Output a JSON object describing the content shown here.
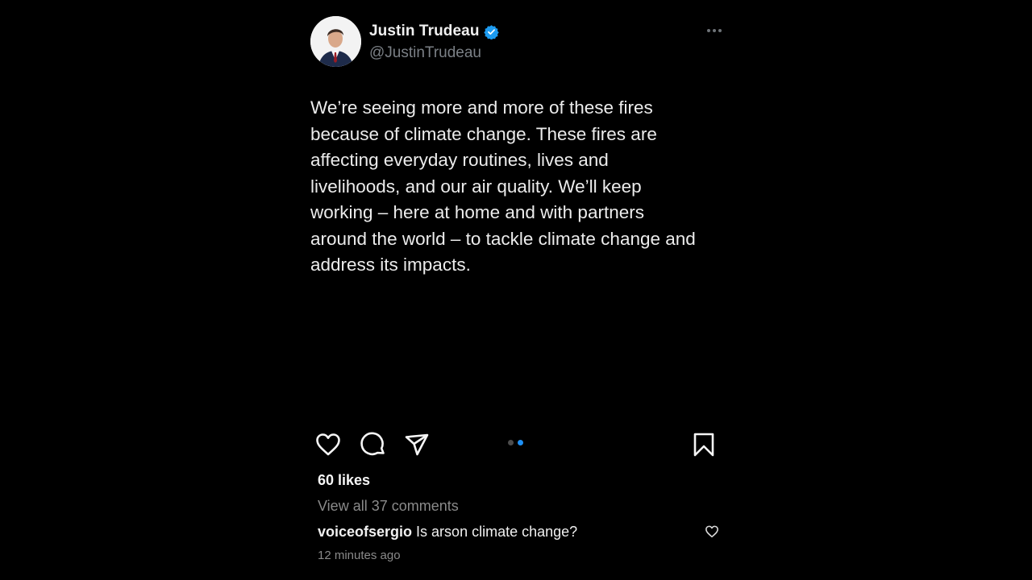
{
  "tweet": {
    "author_name": "Justin Trudeau",
    "handle": "@JustinTrudeau",
    "verified_icon": "verified-badge-icon",
    "more_icon": "more-options-icon",
    "text": "We’re seeing more and more of these fires\nbecause of climate change. These fires are\naffecting everyday routines, lives and\nlivelihoods, and our air quality. We’ll keep\nworking – here at home and with partners\naround the world – to tackle climate change and\naddress its impacts."
  },
  "post": {
    "icons": [
      "heart-icon",
      "comment-icon",
      "share-icon",
      "bookmark-icon"
    ],
    "carousel": {
      "count": 2,
      "active_index": 1
    },
    "likes": "60 likes",
    "view_comments": "View all 37 comments",
    "comment": {
      "user": "voiceofsergio",
      "text": " Is arson climate change?"
    },
    "timestamp": "12 minutes ago"
  },
  "colors": {
    "background": "#000000",
    "verified": "#1d9bf0",
    "active_dot": "#1e90f5",
    "secondary_text": "#8a8a8a"
  }
}
